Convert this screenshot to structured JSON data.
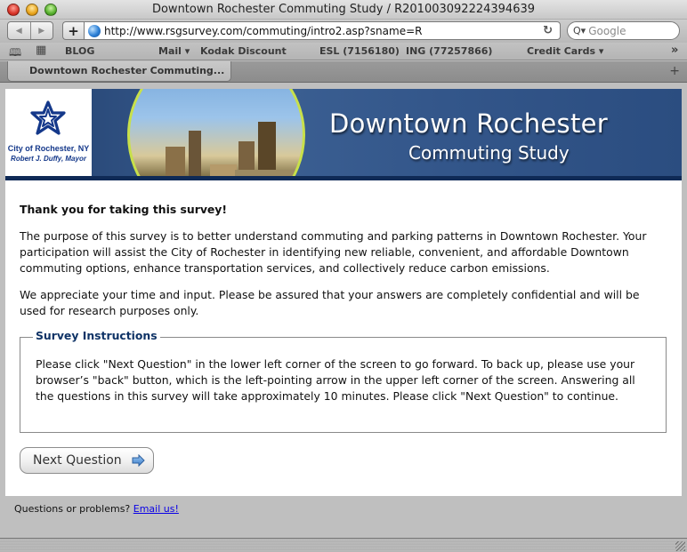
{
  "window": {
    "title": "Downtown Rochester Commuting Study / R201003092224394639"
  },
  "toolbar": {
    "back_icon": "back-arrow-icon",
    "forward_icon": "forward-arrow-icon",
    "add_bookmark_label": "+",
    "url": "http://www.rsgsurvey.com/commuting/intro2.asp?sname=R",
    "reload_glyph": "↻",
    "search_placeholder": "Google",
    "search_glyph": "Q▾"
  },
  "bookmarks": {
    "book_icon": "📖",
    "grid_icon": "▦",
    "items": [
      {
        "label": "BLOG"
      },
      {
        "label": "Mail ▾"
      },
      {
        "label": "Kodak Discount"
      },
      {
        "label": "ESL (7156180)"
      },
      {
        "label": "ING (77257866)"
      },
      {
        "label": "Credit Cards ▾"
      }
    ],
    "overflow_glyph": "»"
  },
  "tabs": {
    "items": [
      {
        "label": "Downtown Rochester Commuting..."
      }
    ],
    "new_tab_glyph": "+"
  },
  "banner": {
    "logo_line1": "City of Rochester, NY",
    "logo_line2": "Robert J. Duffy, Mayor",
    "title": "Downtown Rochester",
    "subtitle": "Commuting Study",
    "colors": {
      "banner_blue": "#2d4d7e",
      "logo_blue": "#14388a",
      "ring_yellow": "#c8e04a"
    }
  },
  "content": {
    "heading": "Thank you for taking this survey!",
    "paragraph1": "The purpose of this survey is to better understand commuting and parking patterns in Downtown Rochester. Your participation will assist the City of Rochester in identifying new reliable, convenient, and affordable Downtown commuting options, enhance transportation services, and collectively reduce carbon emissions.",
    "paragraph2": "We appreciate your time and input. Please be assured that your answers are completely confidential and will be used for research purposes only."
  },
  "instructions": {
    "legend": "Survey Instructions",
    "text": "Please click \"Next Question\" in the lower left corner of the screen to go forward. To back up, please use your browser’s \"back\" button, which is the left-pointing arrow in the upper left corner of the screen. Answering all the questions in this survey will take approximately 10 minutes. Please click \"Next Question\" to continue."
  },
  "next_button": {
    "label": "Next Question"
  },
  "footer": {
    "prefix": "Questions or problems?",
    "link_label": "Email us!",
    "link_color": "#0a00e6"
  }
}
